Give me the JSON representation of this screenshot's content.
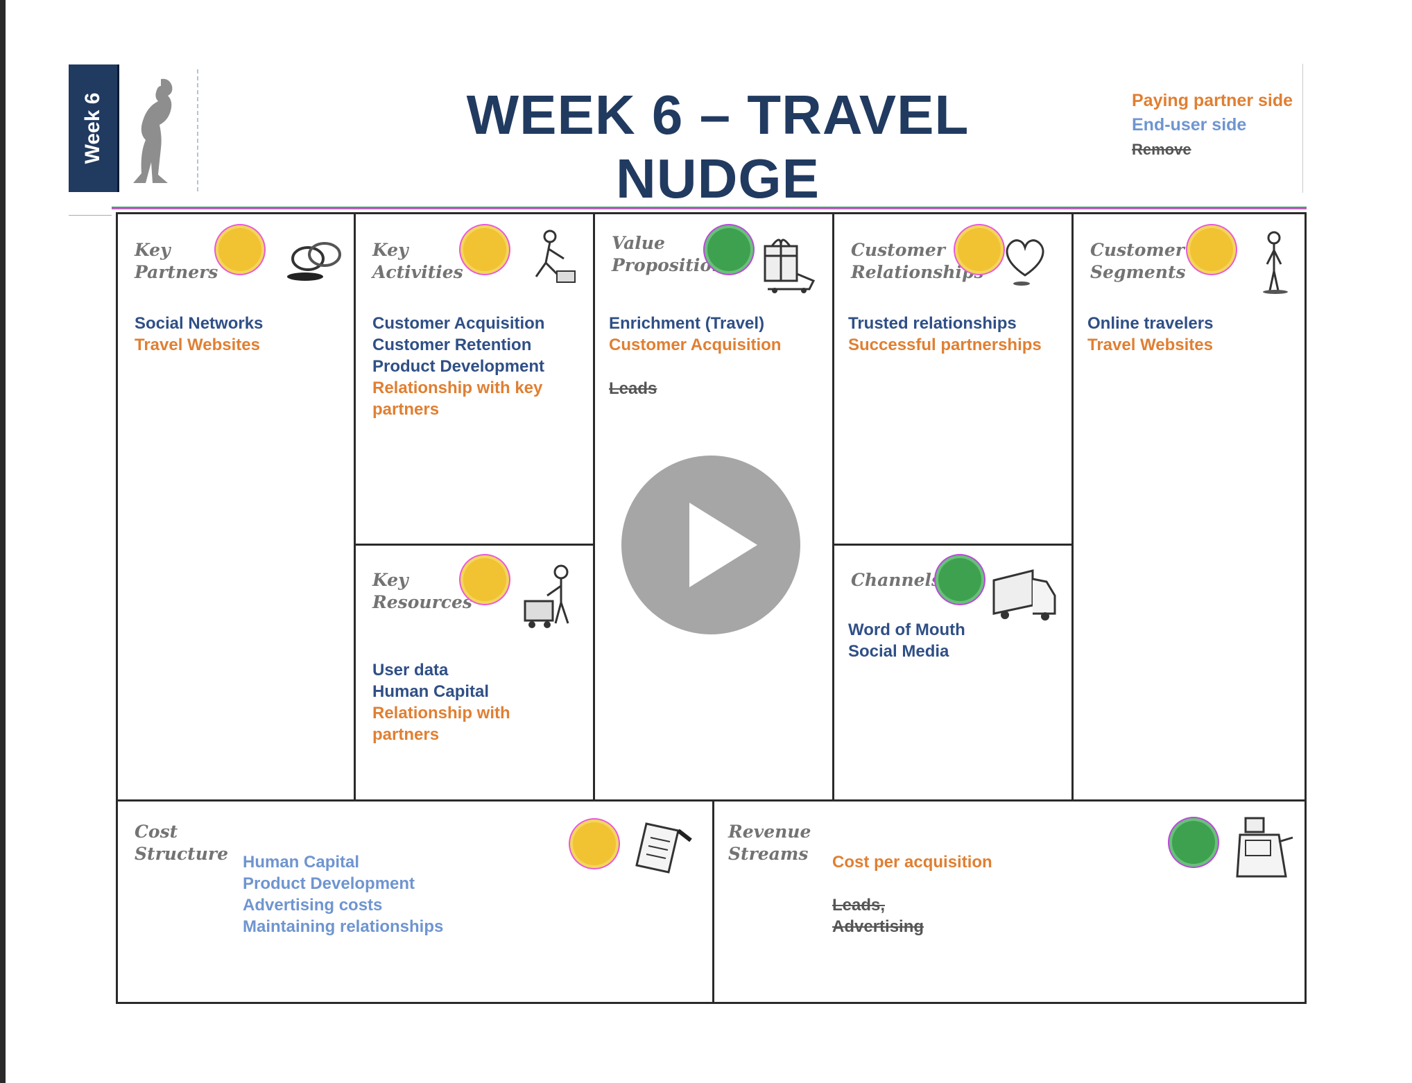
{
  "header": {
    "week_tab": "Week 6",
    "title": "WEEK 6 – TRAVEL NUDGE",
    "legend": {
      "paying": "Paying partner side",
      "enduser": "End-user side",
      "remove": "Remove"
    }
  },
  "blocks": {
    "key_partners": {
      "title": "Key\nPartners",
      "status": "yellow",
      "icon": "chain-links-icon",
      "items": [
        {
          "text": "Social Networks",
          "color": "blue"
        },
        {
          "text": "Travel Websites",
          "color": "orange"
        }
      ]
    },
    "key_activities": {
      "title": "Key\nActivities",
      "status": "yellow",
      "icon": "worker-icon",
      "items": [
        {
          "text": "Customer Acquisition",
          "color": "blue"
        },
        {
          "text": "Customer Retention",
          "color": "blue"
        },
        {
          "text": "Product Development",
          "color": "blue"
        },
        {
          "text": "Relationship with key",
          "color": "orange"
        },
        {
          "text": "partners",
          "color": "orange"
        }
      ]
    },
    "key_resources": {
      "title": "Key\nResources",
      "status": "yellow",
      "icon": "worker-cart-icon",
      "items": [
        {
          "text": "User data",
          "color": "blue"
        },
        {
          "text": "Human Capital",
          "color": "blue"
        },
        {
          "text": "Relationship with",
          "color": "orange"
        },
        {
          "text": "partners",
          "color": "orange"
        }
      ]
    },
    "value_proposition": {
      "title": "Value\nProposition",
      "status": "green",
      "icon": "gift-cart-icon",
      "items": [
        {
          "text": "Enrichment (Travel)",
          "color": "blue"
        },
        {
          "text": "Customer Acquisition",
          "color": "orange"
        }
      ],
      "removed": "Leads"
    },
    "customer_relationships": {
      "title": "Customer\nRelationships",
      "status": "yellow",
      "icon": "heart-icon",
      "items": [
        {
          "text": "Trusted relationships",
          "color": "blue"
        },
        {
          "text": "Successful partnerships",
          "color": "orange"
        }
      ]
    },
    "channels": {
      "title": "Channels",
      "status": "green",
      "icon": "truck-icon",
      "items": [
        {
          "text": "Word of Mouth",
          "color": "blue"
        },
        {
          "text": "Social Media",
          "color": "blue"
        }
      ]
    },
    "customer_segments": {
      "title": "Customer\nSegments",
      "status": "yellow",
      "icon": "person-icon",
      "items": [
        {
          "text": "Online travelers",
          "color": "blue"
        },
        {
          "text": "Travel Websites",
          "color": "orange"
        }
      ]
    },
    "cost_structure": {
      "title": "Cost\nStructure",
      "status": "yellow",
      "icon": "receipt-icon",
      "items": [
        {
          "text": "Human Capital",
          "color": "lightblue"
        },
        {
          "text": "Product Development",
          "color": "lightblue"
        },
        {
          "text": "Advertising costs",
          "color": "lightblue"
        },
        {
          "text": "Maintaining relationships",
          "color": "lightblue"
        }
      ]
    },
    "revenue_streams": {
      "title": "Revenue\nStreams",
      "status": "green",
      "icon": "cash-register-icon",
      "items": [
        {
          "text": "Cost per acquisition",
          "color": "orange"
        }
      ],
      "removed_list": [
        "Leads,",
        "Advertising"
      ]
    }
  },
  "player": {
    "icon": "play-icon"
  },
  "colors": {
    "navy": "#213a60",
    "orange": "#e07f32",
    "blue": "#2f4f86",
    "lightblue": "#6f95d0",
    "yellow_dot": "#f1c232",
    "green_dot": "#3da14f"
  }
}
